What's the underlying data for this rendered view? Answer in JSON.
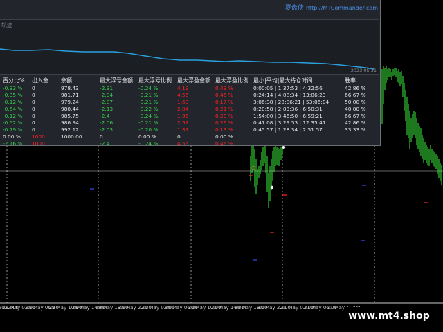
{
  "panel": {
    "brand_cn": "夏盘侠",
    "brand_url": "http://MTCommander.com",
    "curve_title": "轨迹",
    "curve_date": "2023.05.31",
    "colors": {
      "curve": "#2aa0de",
      "positive": "#35d24a",
      "negative": "#ff2020"
    }
  },
  "stats": {
    "headers": [
      "百分比%",
      "出入金",
      "余额",
      "最大浮亏金额",
      "最大浮亏比例",
      "最大浮盈金额",
      "最大浮盈比例",
      "最小|平均|最大持仓时间",
      "胜率"
    ],
    "rows": [
      {
        "pct": "-0.33 %",
        "flow": "0",
        "balance": "978.43",
        "max_loss": "-2.31",
        "max_loss_pct": "-0.24 %",
        "max_gain": "4.19",
        "max_gain_pct": "0.43 %",
        "hold": "0:00:05 | 1:37:53 | 4:32:56",
        "win": "42.86 %"
      },
      {
        "pct": "-0.35 %",
        "flow": "0",
        "balance": "981.71",
        "max_loss": "-2.04",
        "max_loss_pct": "-0.21 %",
        "max_gain": "4.55",
        "max_gain_pct": "0.46 %",
        "hold": "0:24:14 | 4:08:34 | 13:06:23",
        "win": "66.67 %"
      },
      {
        "pct": "-0.12 %",
        "flow": "0",
        "balance": "979.24",
        "max_loss": "-2.07",
        "max_loss_pct": "-0.21 %",
        "max_gain": "1.63",
        "max_gain_pct": "0.17 %",
        "hold": "3:06:38 | 28:06:21 | 53:06:04",
        "win": "50.00 %"
      },
      {
        "pct": "-0.54 %",
        "flow": "0",
        "balance": "980.44",
        "max_loss": "-2.13",
        "max_loss_pct": "-0.22 %",
        "max_gain": "2.04",
        "max_gain_pct": "0.21 %",
        "hold": "0:20:58 | 2:03:36 | 6:50:31",
        "win": "40.00 %"
      },
      {
        "pct": "-0.12 %",
        "flow": "0",
        "balance": "985.75",
        "max_loss": "-2.4",
        "max_loss_pct": "-0.24 %",
        "max_gain": "1.96",
        "max_gain_pct": "0.20 %",
        "hold": "1:54:00 | 3:46:50 | 6:59:21",
        "win": "66.67 %"
      },
      {
        "pct": "-0.52 %",
        "flow": "0",
        "balance": "986.94",
        "max_loss": "-2.06",
        "max_loss_pct": "-0.21 %",
        "max_gain": "2.52",
        "max_gain_pct": "0.26 %",
        "hold": "0:41:08 | 3:29:53 | 12:35:41",
        "win": "42.86 %"
      },
      {
        "pct": "-0.79 %",
        "flow": "0",
        "balance": "992.12",
        "max_loss": "-2.03",
        "max_loss_pct": "-0.20 %",
        "max_gain": "1.31",
        "max_gain_pct": "0.13 %",
        "hold": "0:45:57 | 1:28:34 | 2:51:57",
        "win": "33.33 %"
      },
      {
        "pct": "0.00 %",
        "flow": "1000",
        "balance": "1000.00",
        "max_loss": "0",
        "max_loss_pct": "0.00 %",
        "max_gain": "0",
        "max_gain_pct": "0.00 %",
        "hold": "",
        "win": ""
      },
      {
        "pct": "-2.16 %",
        "flow": "1000",
        "balance": "",
        "max_loss": "-2.4",
        "max_loss_pct": "-0.24 %",
        "max_gain": "4.55",
        "max_gain_pct": "0.46 %",
        "hold": "",
        "win": ""
      }
    ]
  },
  "time_axis": [
    "29 May 2022:00",
    "29 May 02:00",
    "29 May 06:00",
    "29 May 10:00",
    "29 May 14:00",
    "29 May 18:00",
    "29 May 22:00",
    "30 May 02:00",
    "30 May 06:00",
    "30 May 10:00",
    "30 May 14:00",
    "30 May 18:00",
    "30 May 22:00",
    "31 May 02:00",
    "31 May 06:00",
    "31 May 10:00"
  ],
  "watermark": "www.mt4.shop"
}
